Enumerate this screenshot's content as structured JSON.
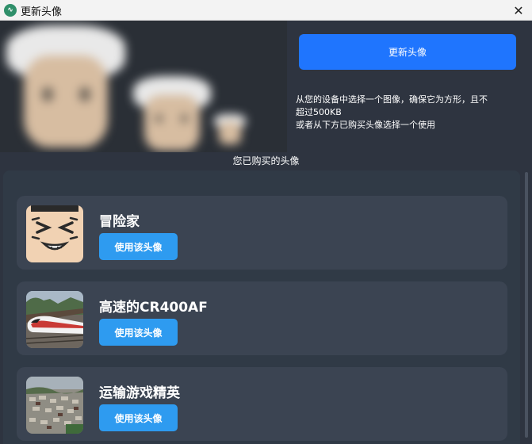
{
  "window": {
    "title": "更新头像",
    "app_icon": "app-logo-icon",
    "close_icon": "close-icon"
  },
  "header": {
    "update_button": "更新头像",
    "description_line1": "从您的设备中选择一个图像，确保它为方形，且不",
    "description_line2": "超过500KB",
    "description_line3": "或者从下方已购买头像选择一个使用"
  },
  "section_title": "您已购买的头像",
  "avatars": [
    {
      "name": "冒险家",
      "button": "使用该头像"
    },
    {
      "name": "高速的CR400AF",
      "button": "使用该头像"
    },
    {
      "name": "运输游戏精英",
      "button": "使用该头像"
    }
  ],
  "colors": {
    "background": "#2e3440",
    "card": "#3b4452",
    "primary_button": "#1f75fe",
    "use_button": "#2e9bf0"
  }
}
